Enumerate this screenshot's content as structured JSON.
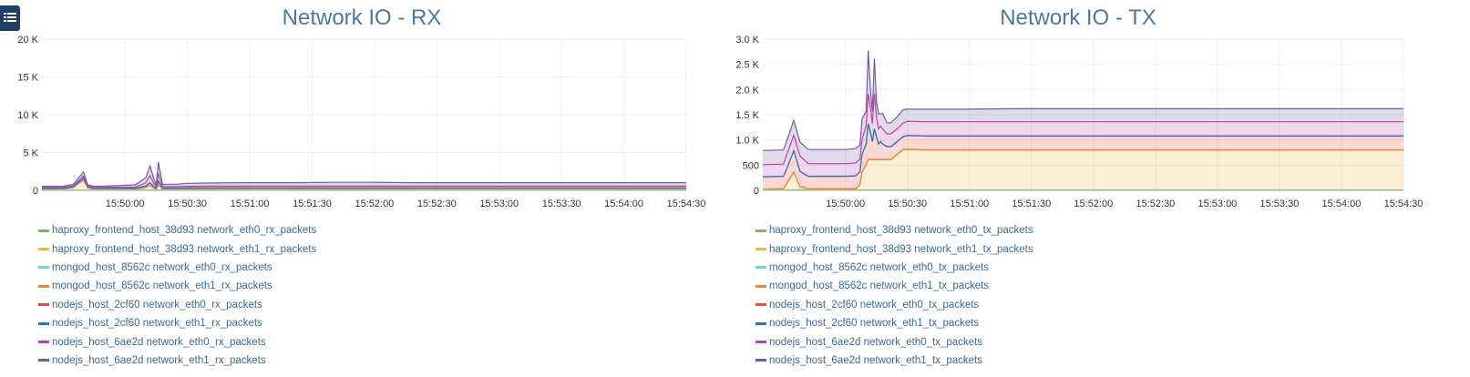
{
  "menu": {
    "icon": "list-menu-icon"
  },
  "chart_data": [
    {
      "type": "area",
      "title": "Network IO - RX",
      "yticks": [
        "0",
        "5 K",
        "10 K",
        "15 K",
        "20 K"
      ],
      "ylim": [
        0,
        20000
      ],
      "xticks": [
        "15:50:00",
        "15:50:30",
        "15:51:00",
        "15:51:30",
        "15:52:00",
        "15:52:30",
        "15:53:00",
        "15:53:30",
        "15:54:00",
        "15:54:30"
      ],
      "xlim_seconds": [
        -40,
        270
      ],
      "x": [
        -40,
        -30,
        -25,
        -20,
        -18,
        -15,
        -12,
        -5,
        0,
        5,
        10,
        12,
        14,
        15,
        16,
        18,
        20,
        22,
        23,
        25,
        28,
        30,
        40,
        60,
        80,
        100,
        120,
        140,
        160,
        180,
        200,
        220,
        240,
        260,
        270
      ],
      "stacked": true,
      "grid": true,
      "legend_position": "bottom",
      "series": [
        {
          "name": "haproxy_frontend_host_38d93 network_eth0_rx_packets",
          "color": "#7eb26d",
          "values": [
            20,
            20,
            20,
            20,
            20,
            20,
            20,
            20,
            20,
            20,
            20,
            20,
            20,
            20,
            20,
            20,
            20,
            20,
            20,
            20,
            20,
            20,
            20,
            20,
            20,
            20,
            20,
            20,
            20,
            20,
            20,
            20,
            20,
            20,
            20
          ]
        },
        {
          "name": "haproxy_frontend_host_38d93 network_eth1_rx_packets",
          "color": "#eab839",
          "values": [
            100,
            100,
            300,
            1300,
            300,
            120,
            100,
            100,
            100,
            100,
            300,
            600,
            200,
            100,
            700,
            100,
            100,
            100,
            100,
            100,
            100,
            100,
            100,
            100,
            100,
            100,
            100,
            100,
            100,
            100,
            100,
            100,
            100,
            100,
            100
          ]
        },
        {
          "name": "mongod_host_8562c network_eth0_rx_packets",
          "color": "#6ed0e0",
          "values": [
            20,
            20,
            20,
            20,
            20,
            20,
            20,
            20,
            20,
            20,
            20,
            20,
            20,
            20,
            20,
            20,
            20,
            20,
            20,
            20,
            20,
            20,
            20,
            20,
            20,
            20,
            20,
            20,
            20,
            20,
            20,
            20,
            20,
            20,
            20
          ]
        },
        {
          "name": "mongod_host_8562c network_eth1_rx_packets",
          "color": "#ef843c",
          "values": [
            60,
            60,
            60,
            60,
            60,
            60,
            60,
            60,
            60,
            60,
            60,
            60,
            60,
            60,
            60,
            60,
            60,
            60,
            60,
            60,
            60,
            60,
            60,
            60,
            60,
            60,
            60,
            60,
            60,
            60,
            60,
            60,
            60,
            60,
            60
          ]
        },
        {
          "name": "nodejs_host_2cf60 network_eth0_rx_packets",
          "color": "#e24d42",
          "values": [
            50,
            50,
            50,
            200,
            50,
            50,
            50,
            60,
            60,
            60,
            150,
            300,
            120,
            60,
            400,
            60,
            80,
            80,
            80,
            80,
            100,
            100,
            110,
            110,
            110,
            110,
            110,
            110,
            110,
            110,
            110,
            110,
            110,
            110,
            110
          ]
        },
        {
          "name": "nodejs_host_2cf60 network_eth1_rx_packets",
          "color": "#1f78c1",
          "values": [
            30,
            30,
            30,
            30,
            30,
            30,
            30,
            30,
            30,
            30,
            30,
            30,
            30,
            30,
            30,
            30,
            30,
            30,
            30,
            30,
            30,
            30,
            30,
            30,
            30,
            30,
            30,
            30,
            30,
            30,
            30,
            30,
            30,
            30,
            30
          ]
        },
        {
          "name": "nodejs_host_6ae2d network_eth0_rx_packets",
          "color": "#ba43a9",
          "values": [
            100,
            100,
            100,
            300,
            100,
            100,
            100,
            120,
            120,
            150,
            400,
            900,
            400,
            150,
            1000,
            200,
            200,
            200,
            200,
            200,
            200,
            200,
            220,
            220,
            220,
            220,
            220,
            220,
            220,
            220,
            220,
            220,
            220,
            220,
            220
          ]
        },
        {
          "name": "nodejs_host_6ae2d network_eth1_rx_packets",
          "color": "#705da0",
          "values": [
            150,
            150,
            200,
            500,
            150,
            150,
            150,
            200,
            250,
            300,
            700,
            1300,
            500,
            300,
            1500,
            300,
            300,
            300,
            300,
            300,
            350,
            400,
            400,
            450,
            450,
            500,
            500,
            450,
            450,
            450,
            450,
            450,
            450,
            450,
            450
          ]
        }
      ]
    },
    {
      "type": "area",
      "title": "Network IO - TX",
      "yticks": [
        "0",
        "500",
        "1.0 K",
        "1.5 K",
        "2.0 K",
        "2.5 K",
        "3.0 K"
      ],
      "ylim": [
        0,
        3000
      ],
      "xticks": [
        "15:50:00",
        "15:50:30",
        "15:51:00",
        "15:51:30",
        "15:52:00",
        "15:52:30",
        "15:53:00",
        "15:53:30",
        "15:54:00",
        "15:54:30"
      ],
      "xlim_seconds": [
        -40,
        270
      ],
      "x": [
        -40,
        -30,
        -28,
        -25,
        -22,
        -18,
        -10,
        0,
        5,
        7,
        8,
        10,
        11,
        12,
        13,
        14,
        15,
        16,
        17,
        18,
        20,
        22,
        25,
        28,
        30,
        40,
        60,
        80,
        100,
        120,
        140,
        160,
        180,
        200,
        220,
        240,
        260,
        270
      ],
      "stacked": true,
      "grid": true,
      "legend_position": "bottom",
      "series": [
        {
          "name": "haproxy_frontend_host_38d93 network_eth0_tx_packets",
          "color": "#7eb26d",
          "values": [
            5,
            5,
            5,
            5,
            5,
            5,
            5,
            5,
            5,
            5,
            5,
            5,
            5,
            5,
            5,
            5,
            5,
            5,
            5,
            5,
            5,
            5,
            5,
            5,
            5,
            5,
            5,
            5,
            5,
            5,
            5,
            5,
            5,
            5,
            5,
            5,
            5,
            5
          ]
        },
        {
          "name": "haproxy_frontend_host_38d93 network_eth1_tx_packets",
          "color": "#eab839",
          "values": [
            5,
            20,
            150,
            350,
            60,
            20,
            20,
            20,
            20,
            100,
            350,
            500,
            600,
            600,
            600,
            600,
            600,
            600,
            600,
            600,
            600,
            600,
            700,
            800,
            800,
            790,
            790,
            790,
            790,
            790,
            790,
            790,
            790,
            790,
            790,
            790,
            790,
            790
          ]
        },
        {
          "name": "mongod_host_8562c network_eth0_tx_packets",
          "color": "#6ed0e0",
          "values": [
            5,
            5,
            5,
            5,
            5,
            5,
            5,
            5,
            5,
            5,
            5,
            5,
            5,
            5,
            5,
            5,
            5,
            5,
            5,
            5,
            5,
            5,
            5,
            5,
            5,
            5,
            5,
            5,
            5,
            5,
            5,
            5,
            5,
            5,
            5,
            5,
            5,
            5
          ]
        },
        {
          "name": "mongod_host_8562c network_eth1_tx_packets",
          "color": "#ef843c",
          "values": [
            5,
            5,
            5,
            5,
            5,
            5,
            5,
            5,
            5,
            5,
            5,
            5,
            5,
            5,
            5,
            5,
            5,
            5,
            5,
            5,
            5,
            5,
            5,
            5,
            5,
            5,
            5,
            5,
            5,
            5,
            5,
            5,
            5,
            5,
            5,
            5,
            5,
            5
          ]
        },
        {
          "name": "nodejs_host_2cf60 network_eth0_tx_packets",
          "color": "#e24d42",
          "values": [
            245,
            240,
            300,
            420,
            300,
            240,
            240,
            240,
            250,
            250,
            350,
            400,
            700,
            550,
            350,
            600,
            450,
            300,
            350,
            300,
            250,
            250,
            250,
            250,
            270,
            270,
            270,
            270,
            270,
            270,
            270,
            270,
            270,
            270,
            270,
            270,
            270,
            270
          ]
        },
        {
          "name": "nodejs_host_2cf60 network_eth1_tx_packets",
          "color": "#1f78c1",
          "values": [
            5,
            5,
            5,
            5,
            5,
            5,
            5,
            5,
            5,
            5,
            5,
            5,
            5,
            5,
            5,
            5,
            5,
            5,
            5,
            5,
            5,
            5,
            5,
            5,
            5,
            5,
            5,
            5,
            5,
            5,
            5,
            5,
            5,
            5,
            5,
            5,
            5,
            5
          ]
        },
        {
          "name": "nodejs_host_6ae2d network_eth0_tx_packets",
          "color": "#ba43a9",
          "values": [
            240,
            240,
            280,
            300,
            300,
            250,
            250,
            250,
            250,
            250,
            300,
            350,
            600,
            500,
            350,
            700,
            400,
            300,
            300,
            300,
            250,
            250,
            250,
            270,
            280,
            280,
            280,
            280,
            280,
            280,
            280,
            280,
            280,
            280,
            280,
            280,
            280,
            280
          ]
        },
        {
          "name": "nodejs_host_6ae2d network_eth1_tx_packets",
          "color": "#705da0",
          "values": [
            280,
            280,
            280,
            300,
            280,
            280,
            280,
            280,
            290,
            280,
            400,
            300,
            850,
            400,
            250,
            700,
            300,
            300,
            250,
            300,
            220,
            220,
            240,
            260,
            240,
            250,
            250,
            260,
            260,
            260,
            260,
            260,
            260,
            260,
            260,
            260,
            260,
            260
          ]
        }
      ]
    }
  ]
}
